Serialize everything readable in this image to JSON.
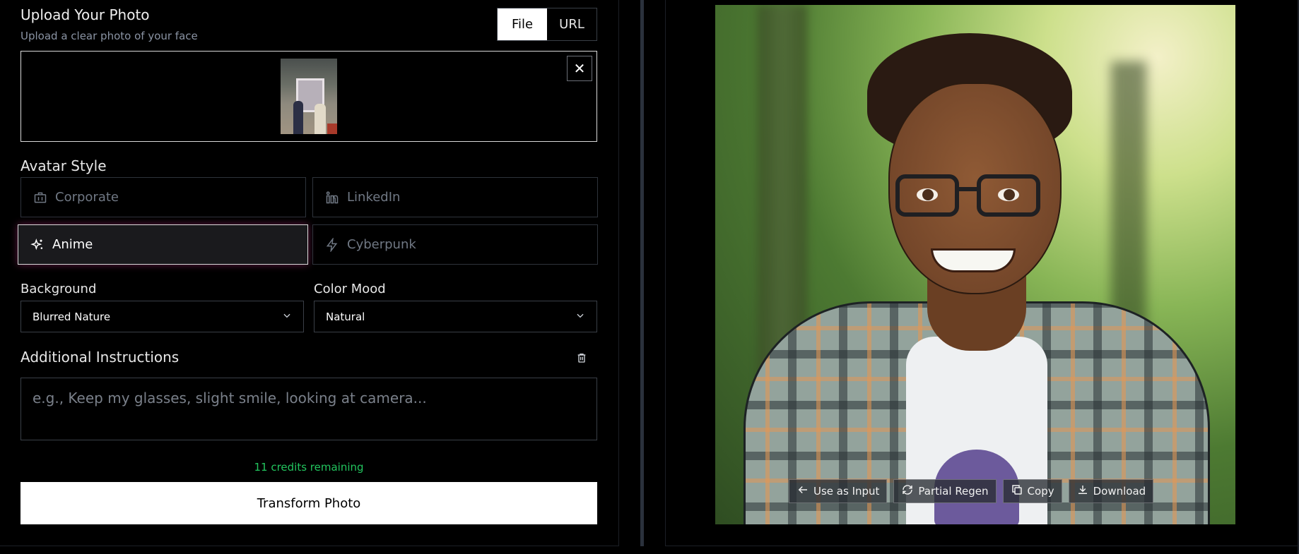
{
  "upload": {
    "title": "Upload Your Photo",
    "subtitle": "Upload a clear photo of your face",
    "source_tabs": {
      "file": "File",
      "url": "URL",
      "active": "File"
    }
  },
  "avatar_style": {
    "title": "Avatar Style",
    "options": [
      {
        "label": "Corporate",
        "icon": "briefcase-icon"
      },
      {
        "label": "LinkedIn",
        "icon": "linkedin-icon"
      },
      {
        "label": "Anime",
        "icon": "sparkles-icon"
      },
      {
        "label": "Cyberpunk",
        "icon": "lightning-icon"
      }
    ],
    "selected": "Anime"
  },
  "background": {
    "label": "Background",
    "value": "Blurred Nature"
  },
  "color_mood": {
    "label": "Color Mood",
    "value": "Natural"
  },
  "instructions": {
    "title": "Additional Instructions",
    "placeholder": "e.g., Keep my glasses, slight smile, looking at camera...",
    "value": ""
  },
  "credits": "11 credits remaining",
  "transform_label": "Transform Photo",
  "result_actions": {
    "use_as_input": "Use as Input",
    "partial_regen": "Partial Regen",
    "copy": "Copy",
    "download": "Download"
  },
  "colors": {
    "accent_success": "#22c55e",
    "selected_glow": "#dc3c96",
    "primary_button": "#ffffff"
  }
}
